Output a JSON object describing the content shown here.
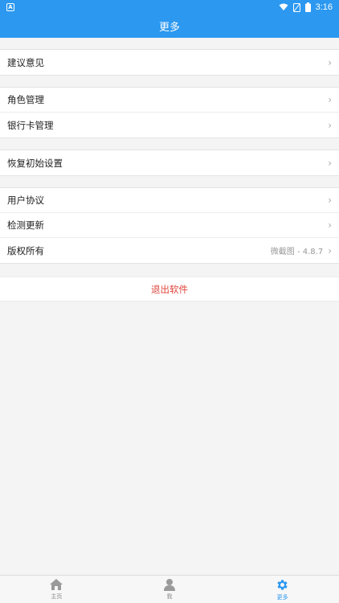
{
  "status_bar": {
    "notification_icon": "A",
    "icons": [
      "wifi-icon",
      "signal-off-icon",
      "battery-icon"
    ],
    "time": "3:16"
  },
  "header": {
    "title": "更多"
  },
  "groups": [
    {
      "items": [
        {
          "label": "建议意见"
        }
      ]
    },
    {
      "items": [
        {
          "label": "角色管理"
        },
        {
          "label": "银行卡管理"
        }
      ]
    },
    {
      "items": [
        {
          "label": "恢复初始设置"
        }
      ]
    },
    {
      "items": [
        {
          "label": "用户协议"
        },
        {
          "label": "检测更新"
        },
        {
          "label": "版权所有",
          "value": "微截图 - 4.8.7"
        }
      ]
    }
  ],
  "logout": {
    "label": "退出软件"
  },
  "tabbar": {
    "tabs": [
      {
        "label": "主页",
        "icon": "home-icon"
      },
      {
        "label": "我",
        "icon": "user-icon"
      },
      {
        "label": "更多",
        "icon": "gear-icon",
        "active": true
      }
    ]
  },
  "colors": {
    "primary": "#2c98f0",
    "danger": "#e0453b",
    "background": "#f4f4f4"
  }
}
